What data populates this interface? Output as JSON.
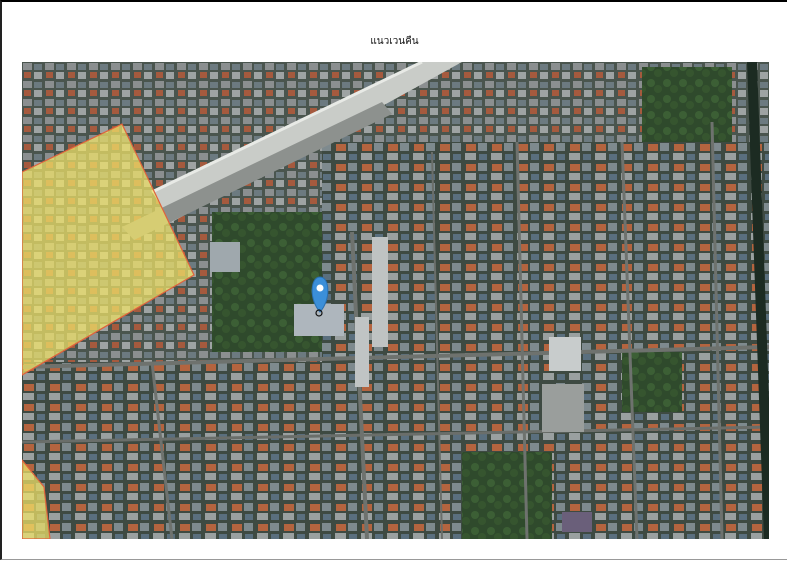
{
  "title": "แนวเวนคืน",
  "map": {
    "expropriation_zone_color": "#f2e56a",
    "expropriation_zone_border": "#e0623c",
    "marker_color": "#3b8fd9",
    "marker_icon": "map-pin-icon"
  }
}
